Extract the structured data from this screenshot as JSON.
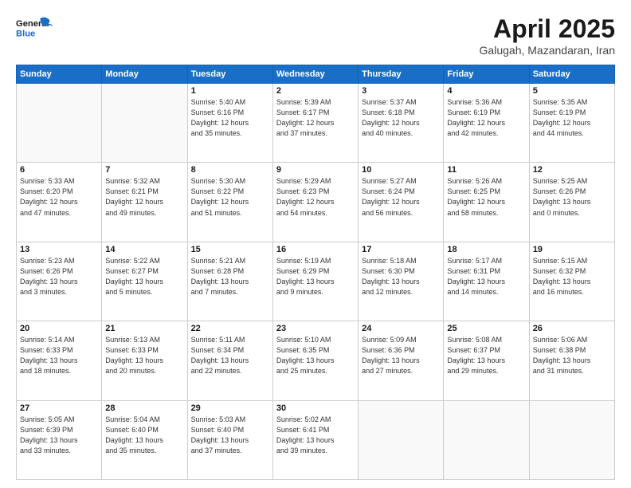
{
  "header": {
    "logo_line1": "General",
    "logo_line2": "Blue",
    "month_title": "April 2025",
    "location": "Galugah, Mazandaran, Iran"
  },
  "weekdays": [
    "Sunday",
    "Monday",
    "Tuesday",
    "Wednesday",
    "Thursday",
    "Friday",
    "Saturday"
  ],
  "weeks": [
    [
      {
        "day": "",
        "detail": ""
      },
      {
        "day": "",
        "detail": ""
      },
      {
        "day": "1",
        "detail": "Sunrise: 5:40 AM\nSunset: 6:16 PM\nDaylight: 12 hours\nand 35 minutes."
      },
      {
        "day": "2",
        "detail": "Sunrise: 5:39 AM\nSunset: 6:17 PM\nDaylight: 12 hours\nand 37 minutes."
      },
      {
        "day": "3",
        "detail": "Sunrise: 5:37 AM\nSunset: 6:18 PM\nDaylight: 12 hours\nand 40 minutes."
      },
      {
        "day": "4",
        "detail": "Sunrise: 5:36 AM\nSunset: 6:19 PM\nDaylight: 12 hours\nand 42 minutes."
      },
      {
        "day": "5",
        "detail": "Sunrise: 5:35 AM\nSunset: 6:19 PM\nDaylight: 12 hours\nand 44 minutes."
      }
    ],
    [
      {
        "day": "6",
        "detail": "Sunrise: 5:33 AM\nSunset: 6:20 PM\nDaylight: 12 hours\nand 47 minutes."
      },
      {
        "day": "7",
        "detail": "Sunrise: 5:32 AM\nSunset: 6:21 PM\nDaylight: 12 hours\nand 49 minutes."
      },
      {
        "day": "8",
        "detail": "Sunrise: 5:30 AM\nSunset: 6:22 PM\nDaylight: 12 hours\nand 51 minutes."
      },
      {
        "day": "9",
        "detail": "Sunrise: 5:29 AM\nSunset: 6:23 PM\nDaylight: 12 hours\nand 54 minutes."
      },
      {
        "day": "10",
        "detail": "Sunrise: 5:27 AM\nSunset: 6:24 PM\nDaylight: 12 hours\nand 56 minutes."
      },
      {
        "day": "11",
        "detail": "Sunrise: 5:26 AM\nSunset: 6:25 PM\nDaylight: 12 hours\nand 58 minutes."
      },
      {
        "day": "12",
        "detail": "Sunrise: 5:25 AM\nSunset: 6:26 PM\nDaylight: 13 hours\nand 0 minutes."
      }
    ],
    [
      {
        "day": "13",
        "detail": "Sunrise: 5:23 AM\nSunset: 6:26 PM\nDaylight: 13 hours\nand 3 minutes."
      },
      {
        "day": "14",
        "detail": "Sunrise: 5:22 AM\nSunset: 6:27 PM\nDaylight: 13 hours\nand 5 minutes."
      },
      {
        "day": "15",
        "detail": "Sunrise: 5:21 AM\nSunset: 6:28 PM\nDaylight: 13 hours\nand 7 minutes."
      },
      {
        "day": "16",
        "detail": "Sunrise: 5:19 AM\nSunset: 6:29 PM\nDaylight: 13 hours\nand 9 minutes."
      },
      {
        "day": "17",
        "detail": "Sunrise: 5:18 AM\nSunset: 6:30 PM\nDaylight: 13 hours\nand 12 minutes."
      },
      {
        "day": "18",
        "detail": "Sunrise: 5:17 AM\nSunset: 6:31 PM\nDaylight: 13 hours\nand 14 minutes."
      },
      {
        "day": "19",
        "detail": "Sunrise: 5:15 AM\nSunset: 6:32 PM\nDaylight: 13 hours\nand 16 minutes."
      }
    ],
    [
      {
        "day": "20",
        "detail": "Sunrise: 5:14 AM\nSunset: 6:33 PM\nDaylight: 13 hours\nand 18 minutes."
      },
      {
        "day": "21",
        "detail": "Sunrise: 5:13 AM\nSunset: 6:33 PM\nDaylight: 13 hours\nand 20 minutes."
      },
      {
        "day": "22",
        "detail": "Sunrise: 5:11 AM\nSunset: 6:34 PM\nDaylight: 13 hours\nand 22 minutes."
      },
      {
        "day": "23",
        "detail": "Sunrise: 5:10 AM\nSunset: 6:35 PM\nDaylight: 13 hours\nand 25 minutes."
      },
      {
        "day": "24",
        "detail": "Sunrise: 5:09 AM\nSunset: 6:36 PM\nDaylight: 13 hours\nand 27 minutes."
      },
      {
        "day": "25",
        "detail": "Sunrise: 5:08 AM\nSunset: 6:37 PM\nDaylight: 13 hours\nand 29 minutes."
      },
      {
        "day": "26",
        "detail": "Sunrise: 5:06 AM\nSunset: 6:38 PM\nDaylight: 13 hours\nand 31 minutes."
      }
    ],
    [
      {
        "day": "27",
        "detail": "Sunrise: 5:05 AM\nSunset: 6:39 PM\nDaylight: 13 hours\nand 33 minutes."
      },
      {
        "day": "28",
        "detail": "Sunrise: 5:04 AM\nSunset: 6:40 PM\nDaylight: 13 hours\nand 35 minutes."
      },
      {
        "day": "29",
        "detail": "Sunrise: 5:03 AM\nSunset: 6:40 PM\nDaylight: 13 hours\nand 37 minutes."
      },
      {
        "day": "30",
        "detail": "Sunrise: 5:02 AM\nSunset: 6:41 PM\nDaylight: 13 hours\nand 39 minutes."
      },
      {
        "day": "",
        "detail": ""
      },
      {
        "day": "",
        "detail": ""
      },
      {
        "day": "",
        "detail": ""
      }
    ]
  ]
}
